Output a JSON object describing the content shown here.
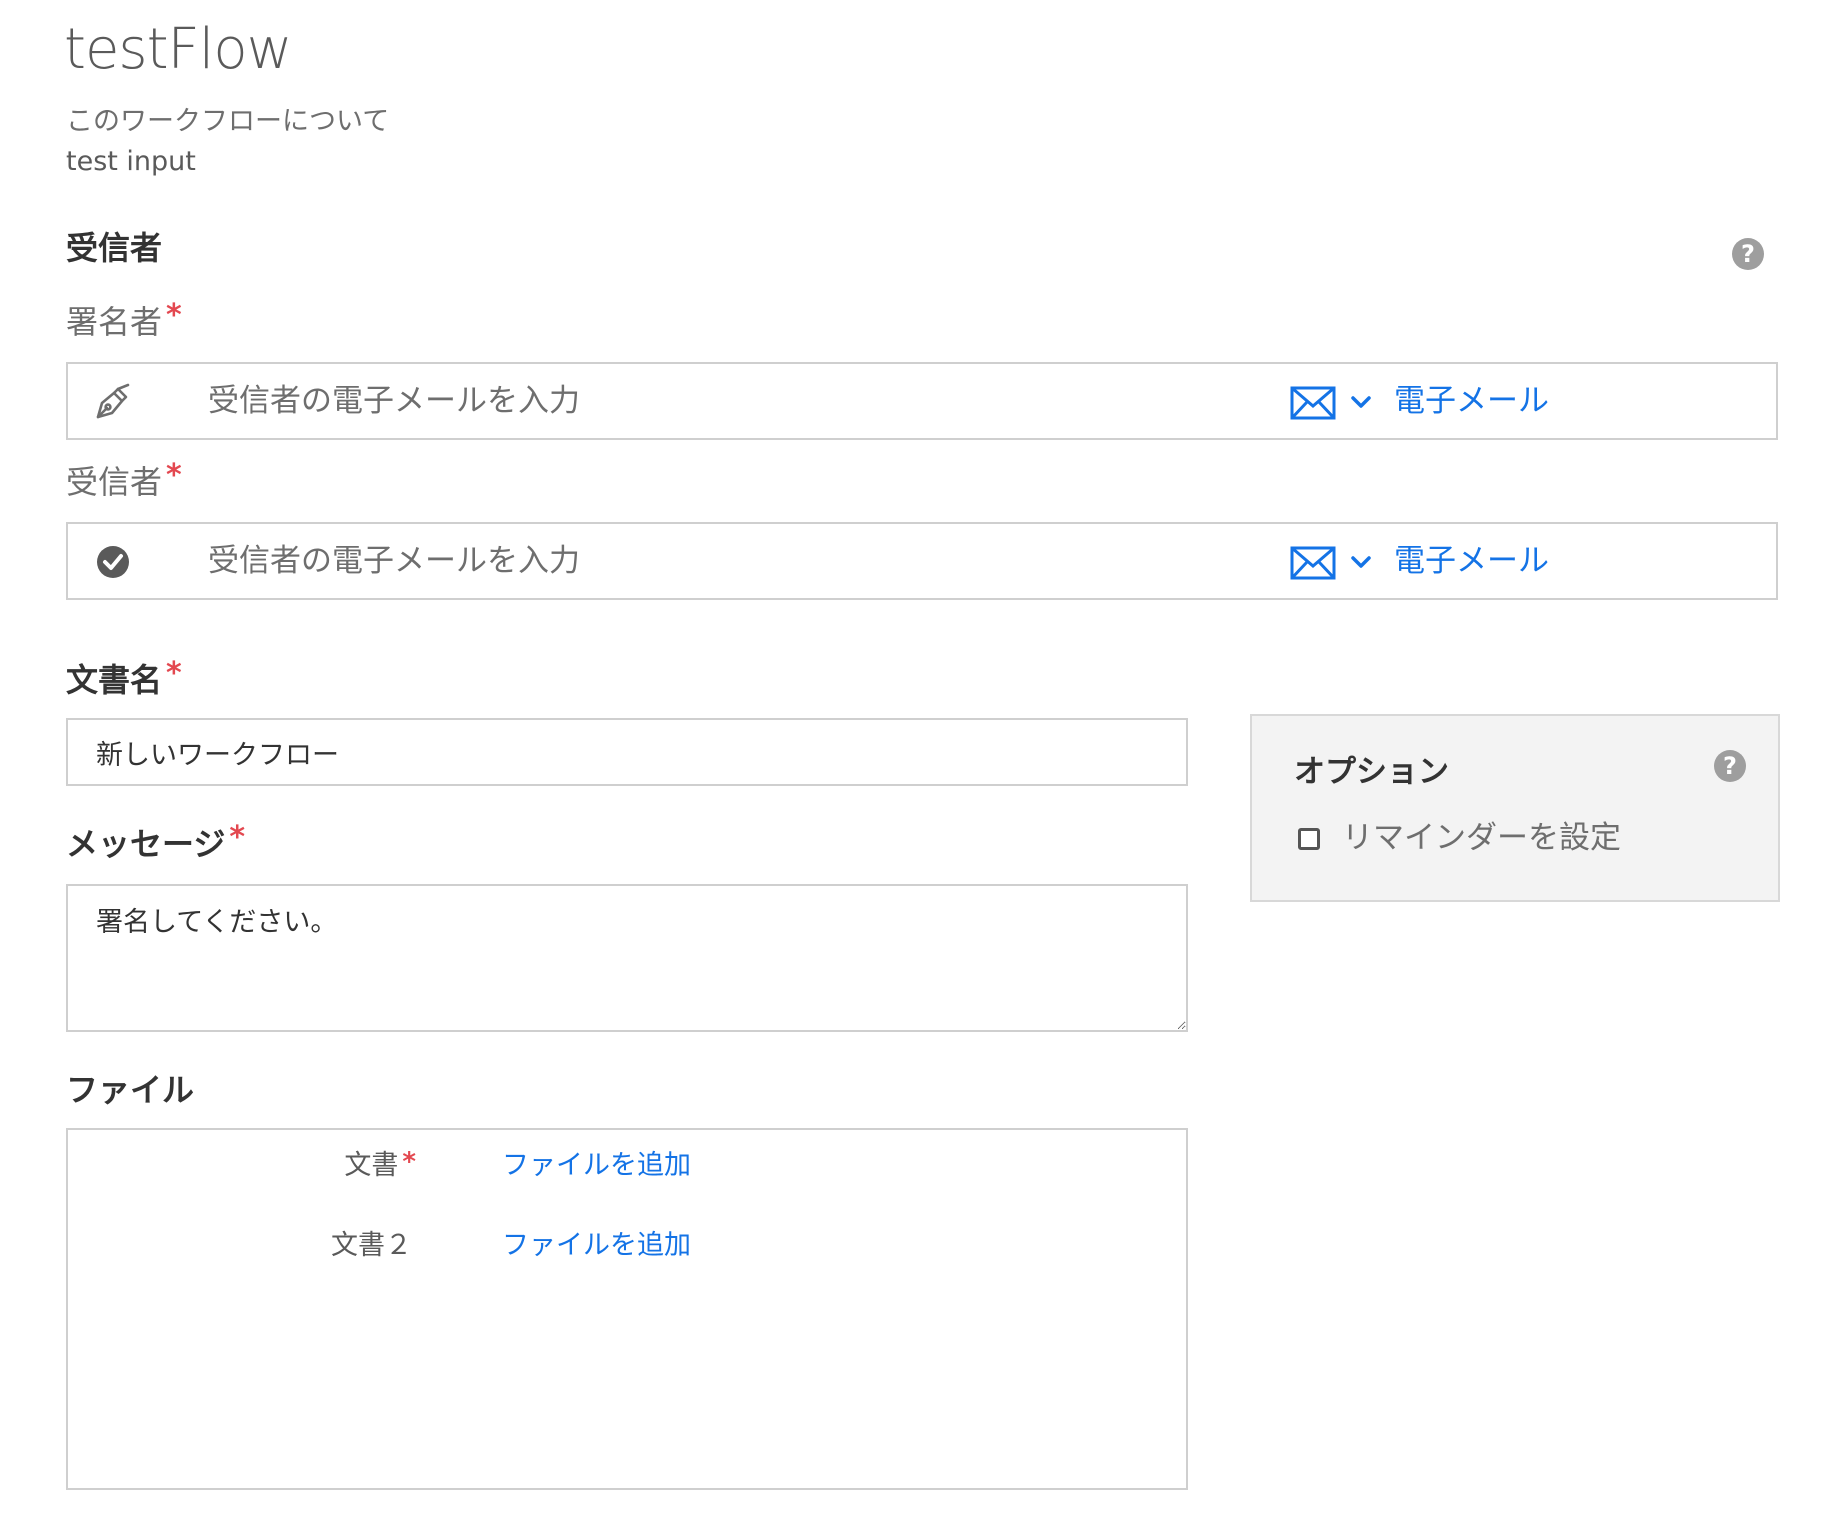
{
  "workflow": {
    "title": "testFlow",
    "about_label": "このワークフローについて",
    "about_text": "test input"
  },
  "recipients": {
    "heading": "受信者",
    "help_icon": "help-icon",
    "rows": [
      {
        "label": "署名者",
        "required_mark": "*",
        "role_icon": "pen-icon",
        "placeholder": "受信者の電子メールを入力",
        "value": "",
        "auth_icon": "envelope-icon",
        "auth_label": "電子メール"
      },
      {
        "label": "受信者",
        "required_mark": "*",
        "role_icon": "checkmark-circle-icon",
        "placeholder": "受信者の電子メールを入力",
        "value": "",
        "auth_icon": "envelope-icon",
        "auth_label": "電子メール"
      }
    ]
  },
  "document_name": {
    "label": "文書名",
    "required_mark": "*",
    "value": "新しいワークフロー"
  },
  "message": {
    "label": "メッセージ",
    "required_mark": "*",
    "value": "署名してください。"
  },
  "files": {
    "heading": "ファイル",
    "items": [
      {
        "name": "文書",
        "required_mark": "*",
        "action": "ファイルを追加"
      },
      {
        "name": "文書２",
        "required_mark": "",
        "action": "ファイルを追加"
      }
    ]
  },
  "options": {
    "title": "オプション",
    "help_icon": "help-icon",
    "reminder_label": "リマインダーを設定",
    "reminder_checked": false
  },
  "colors": {
    "accent": "#1473e6",
    "required": "#e34850",
    "border": "#cfcfcf",
    "panel_bg": "#f3f3f3"
  }
}
